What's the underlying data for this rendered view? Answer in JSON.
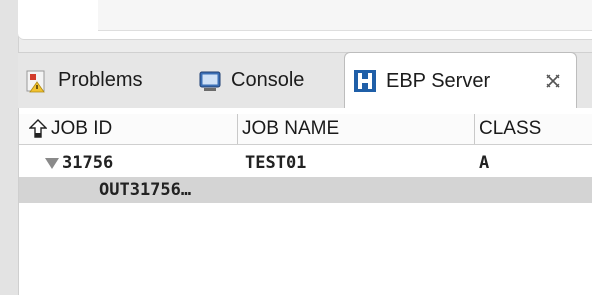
{
  "tabs": [
    {
      "label": "Problems",
      "icon": "problems-icon",
      "active": false
    },
    {
      "label": "Console",
      "icon": "console-icon",
      "active": false
    },
    {
      "label": "EBP Server",
      "icon": "ebp-server-icon",
      "active": true
    }
  ],
  "table": {
    "headers": {
      "job_id": "JOB ID",
      "job_name": "JOB NAME",
      "class": "CLASS"
    },
    "rows": [
      {
        "job_id": "31756",
        "job_name": "TEST01",
        "class": "A",
        "expanded": true
      },
      {
        "child": "OUT31756…",
        "selected": true
      }
    ]
  },
  "colors": {
    "selection": "#d4d4d4",
    "ebp_blue": "#1f5fa8"
  }
}
